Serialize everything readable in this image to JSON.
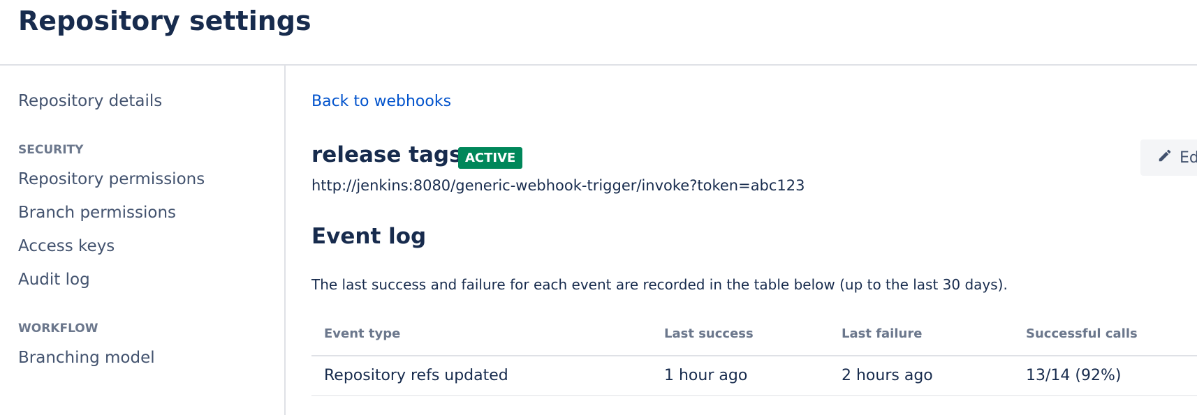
{
  "header": {
    "title": "Repository settings"
  },
  "sidebar": {
    "top_link": "Repository details",
    "sections": [
      {
        "heading": "SECURITY",
        "items": [
          "Repository permissions",
          "Branch permissions",
          "Access keys",
          "Audit log"
        ]
      },
      {
        "heading": "WORKFLOW",
        "items": [
          "Branching model"
        ]
      }
    ]
  },
  "main": {
    "back_link": "Back to webhooks",
    "webhook": {
      "name": "release tags",
      "status": "ACTIVE",
      "url": "http://jenkins:8080/generic-webhook-trigger/invoke?token=abc123",
      "edit_label": "Edit"
    },
    "event_log": {
      "title": "Event log",
      "description": "The last success and failure for each event are recorded in the table below (up to the last 30 days).",
      "columns": [
        "Event type",
        "Last success",
        "Last failure",
        "Successful calls"
      ],
      "rows": [
        {
          "event_type": "Repository refs updated",
          "last_success": "1 hour ago",
          "last_failure": "2 hours ago",
          "successful_calls": "13/14 (92%)"
        }
      ]
    }
  },
  "icons": {
    "edit": "pencil-icon"
  },
  "colors": {
    "active_badge": "#00875a",
    "link": "#0052cc",
    "text": "#172b4d",
    "muted": "#6b778c"
  }
}
